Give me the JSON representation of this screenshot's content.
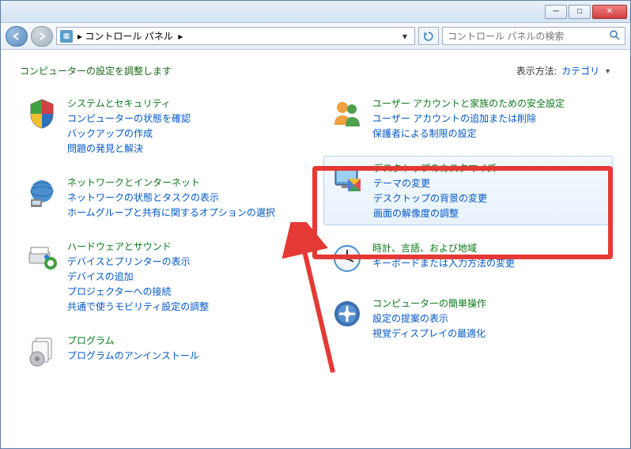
{
  "titlebar": {
    "minimize": "─",
    "maximize": "□",
    "close": "✕"
  },
  "nav": {
    "back": "◀",
    "forward": "▶",
    "breadcrumb": "コントロール パネル",
    "sep": "▸",
    "dropdown": "▾",
    "refresh": "↻"
  },
  "search": {
    "placeholder": "コントロール パネルの検索"
  },
  "header": {
    "title": "コンピューターの設定を調整します",
    "viewmode_label": "表示方法:",
    "viewmode_value": "カテゴリ"
  },
  "left": [
    {
      "title": "システムとセキュリティ",
      "links": [
        "コンピューターの状態を確認",
        "バックアップの作成",
        "問題の発見と解決"
      ]
    },
    {
      "title": "ネットワークとインターネット",
      "links": [
        "ネットワークの状態とタスクの表示",
        "ホームグループと共有に関するオプションの選択"
      ]
    },
    {
      "title": "ハードウェアとサウンド",
      "links": [
        "デバイスとプリンターの表示",
        "デバイスの追加",
        "プロジェクターへの接続",
        "共通で使うモビリティ設定の調整"
      ]
    },
    {
      "title": "プログラム",
      "links": [
        "プログラムのアンインストール"
      ]
    }
  ],
  "right": [
    {
      "title": "ユーザー アカウントと家族のための安全設定",
      "links": [
        "ユーザー アカウントの追加または削除",
        "保護者による制限の設定"
      ]
    },
    {
      "title": "デスクトップのカスタマイズ",
      "links": [
        "テーマの変更",
        "デスクトップの背景の変更",
        "画面の解像度の調整"
      ],
      "highlight": true
    },
    {
      "title": "時計、言語、および地域",
      "links": [
        "キーボードまたは入力方法の変更"
      ]
    },
    {
      "title": "コンピューターの簡単操作",
      "links": [
        "設定の提案の表示",
        "視覚ディスプレイの最適化"
      ]
    }
  ]
}
